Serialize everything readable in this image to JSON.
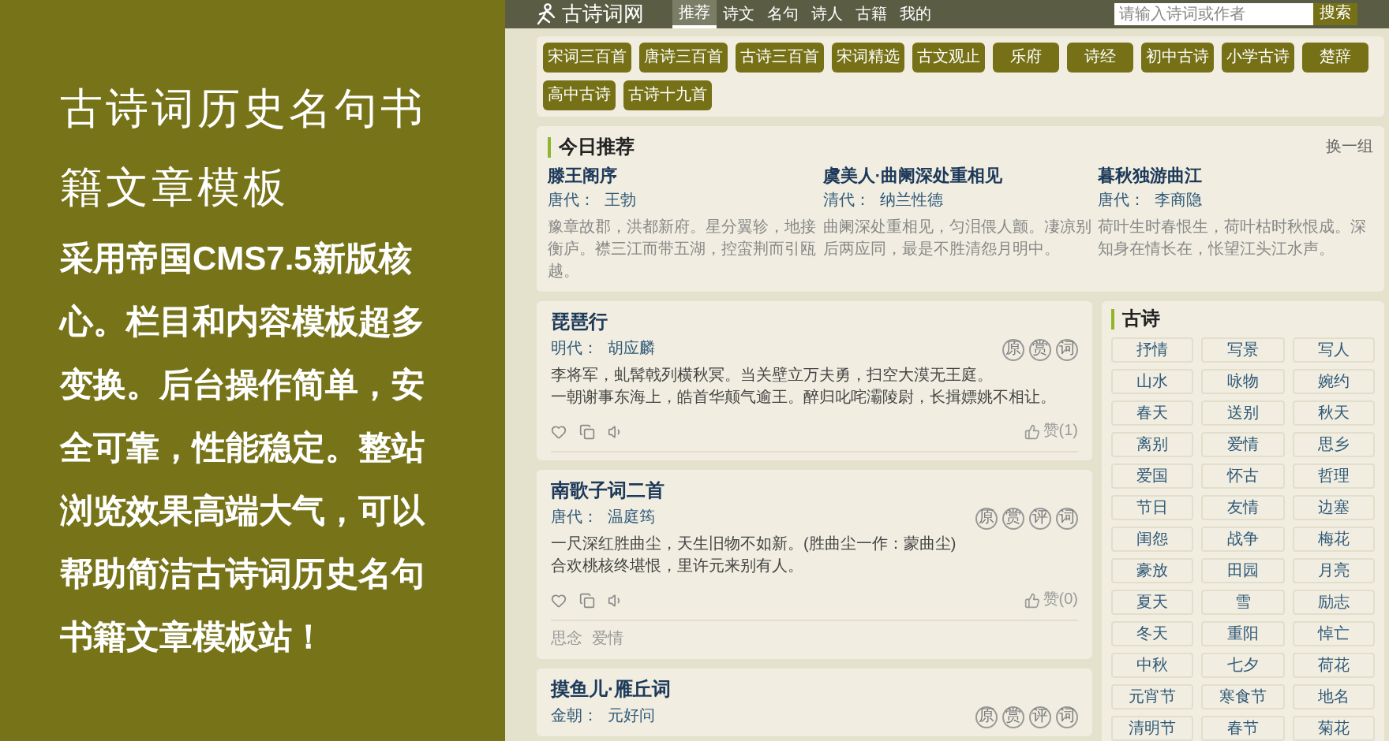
{
  "promo": {
    "title": "古诗词历史名句书籍文章模板",
    "body": "采用帝国CMS7.5新版核心。栏目和内容模板超多变换。后台操作简单，安全可靠，性能稳定。整站浏览效果高端大气，可以帮助简洁古诗词历史名句书籍文章模板站！"
  },
  "site": {
    "logo": "古诗词网",
    "nav": [
      {
        "label": "推荐",
        "selected": true
      },
      {
        "label": "诗文",
        "selected": false
      },
      {
        "label": "名句",
        "selected": false
      },
      {
        "label": "诗人",
        "selected": false
      },
      {
        "label": "古籍",
        "selected": false
      },
      {
        "label": "我的",
        "selected": false
      }
    ],
    "search": {
      "placeholder": "请输入诗词或作者",
      "button": "搜索"
    }
  },
  "categories": [
    "宋词三百首",
    "唐诗三百首",
    "古诗三百首",
    "宋词精选",
    "古文观止",
    "乐府",
    "诗经",
    "初中古诗",
    "小学古诗",
    "楚辞",
    "高中古诗",
    "古诗十九首"
  ],
  "today": {
    "title": "今日推荐",
    "refresh": "换一组",
    "items": [
      {
        "title": "滕王阁序",
        "dynasty": "唐代：",
        "author": "王勃",
        "text": "豫章故郡，洪都新府。星分翼轸，地接衡庐。襟三江而带五湖，控蛮荆而引瓯越。"
      },
      {
        "title": "虞美人·曲阑深处重相见",
        "dynasty": "清代：",
        "author": "纳兰性德",
        "text": "曲阑深处重相见，匀泪偎人颤。凄凉别后两应同，最是不胜清怨月明中。"
      },
      {
        "title": "暮秋独游曲江",
        "dynasty": "唐代：",
        "author": "李商隐",
        "text": "荷叶生时春恨生，荷叶枯时秋恨成。深知身在情长在，怅望江头江水声。"
      }
    ]
  },
  "poems": [
    {
      "title": "琵琶行",
      "dynasty": "明代：",
      "author": "胡应麟",
      "badges": [
        "原",
        "赏",
        "词"
      ],
      "lines": [
        "李将军，虬髯戟列横秋冥。当关壁立万夫勇，扫空大漠无王庭。",
        "一朝谢事东海上，皓首华颠气逾王。醉归叱咤灞陵尉，长揖嫖姚不相让。"
      ],
      "likes": "赞(1)"
    },
    {
      "title": "南歌子词二首",
      "dynasty": "唐代：",
      "author": "温庭筠",
      "badges": [
        "原",
        "赏",
        "评",
        "词"
      ],
      "lines": [
        "一尺深红胜曲尘，天生旧物不如新。(胜曲尘一作：蒙曲尘)",
        "合欢桃核终堪恨，里许元来别有人。"
      ],
      "likes": "赞(0)",
      "tags": [
        "思念",
        "爱情"
      ]
    },
    {
      "title": "摸鱼儿·雁丘词",
      "dynasty": "金朝：",
      "author": "元好问",
      "badges": [
        "原",
        "赏",
        "评",
        "词"
      ]
    }
  ],
  "sidebar": {
    "title": "古诗",
    "tags": [
      "抒情",
      "写景",
      "写人",
      "山水",
      "咏物",
      "婉约",
      "春天",
      "送别",
      "秋天",
      "离别",
      "爱情",
      "思乡",
      "爱国",
      "怀古",
      "哲理",
      "节日",
      "友情",
      "边塞",
      "闺怨",
      "战争",
      "梅花",
      "豪放",
      "田园",
      "月亮",
      "夏天",
      "雪",
      "励志",
      "冬天",
      "重阳",
      "悼亡",
      "中秋",
      "七夕",
      "荷花",
      "元宵节",
      "寒食节",
      "地名",
      "清明节",
      "春节",
      "菊花"
    ]
  }
}
